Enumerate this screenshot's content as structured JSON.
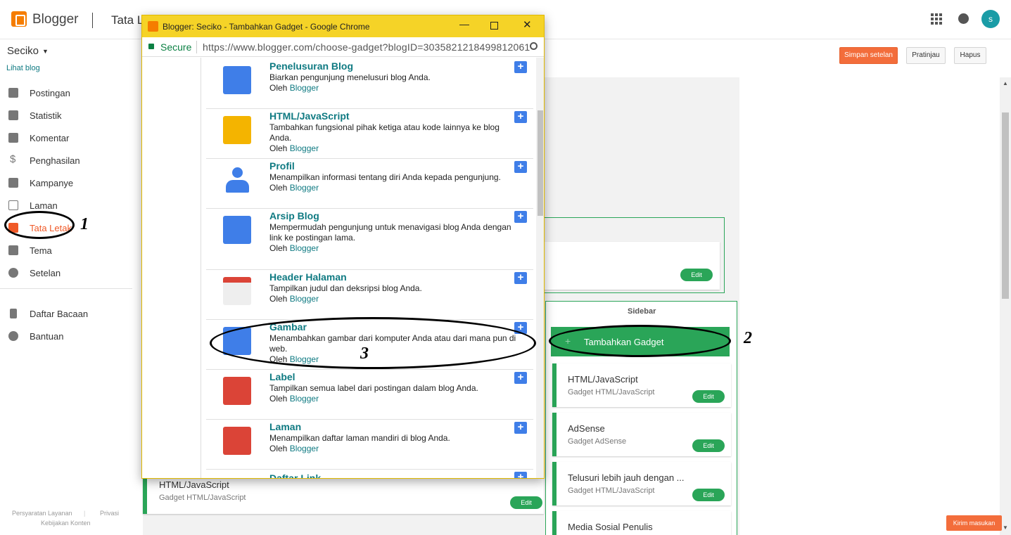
{
  "app": {
    "brand": "Blogger",
    "page_title": "Tata Letak",
    "avatar_letter": "s"
  },
  "blog": {
    "name": "Seciko",
    "view_link": "Lihat blog"
  },
  "toolbar": {
    "save_label": "Simpan setelan",
    "preview_label": "Pratinjau",
    "delete_label": "Hapus"
  },
  "nav": {
    "items": [
      {
        "label": "Postingan",
        "icon": "posts-icon"
      },
      {
        "label": "Statistik",
        "icon": "stats-icon"
      },
      {
        "label": "Komentar",
        "icon": "comments-icon"
      },
      {
        "label": "Penghasilan",
        "icon": "dollar-icon"
      },
      {
        "label": "Kampanye",
        "icon": "campaign-icon"
      },
      {
        "label": "Laman",
        "icon": "pages-icon"
      },
      {
        "label": "Tata Letak",
        "icon": "layout-icon",
        "active": true
      },
      {
        "label": "Tema",
        "icon": "theme-icon"
      },
      {
        "label": "Setelan",
        "icon": "settings-icon"
      },
      {
        "label": "Daftar Bacaan",
        "icon": "bookmark-icon"
      },
      {
        "label": "Bantuan",
        "icon": "help-icon"
      }
    ],
    "footer": {
      "terms": "Persyaratan Layanan",
      "privacy": "Privasi",
      "content_policy": "Kebijakan Konten"
    }
  },
  "layout": {
    "sidebar_title": "Sidebar",
    "add_gadget_label": "Tambahkan Gadget",
    "section_edit_label": "Edit",
    "sidebar_gadgets": [
      {
        "title": "HTML/JavaScript",
        "subtitle": "Gadget HTML/JavaScript",
        "edit": "Edit"
      },
      {
        "title": "AdSense",
        "subtitle": "Gadget AdSense",
        "edit": "Edit"
      },
      {
        "title": "Telusuri lebih jauh dengan ...",
        "subtitle": "Gadget HTML/JavaScript",
        "edit": "Edit"
      },
      {
        "title": "Media Sosial Penulis",
        "subtitle": "",
        "edit": ""
      }
    ],
    "main_gadget": {
      "title": "HTML/JavaScript",
      "subtitle": "Gadget HTML/JavaScript",
      "edit": "Edit"
    },
    "feedback_label": "Kirim masukan"
  },
  "annotations": {
    "one": "1",
    "two": "2",
    "three": "3"
  },
  "popup": {
    "title": "Blogger: Seciko - Tambahkan Gadget - Google Chrome",
    "secure": "Secure",
    "url": "https://www.blogger.com/choose-gadget?blogID=3035821218499812061",
    "author_prefix": "Oleh",
    "author_name": "Blogger",
    "gadgets": [
      {
        "name": "Penelusuran Blog",
        "desc": "Biarkan pengunjung menelusuri blog Anda.",
        "icon": "search-gadget-icon",
        "color": "#3f7ee8"
      },
      {
        "name": "HTML/JavaScript",
        "desc": "Tambahkan fungsional pihak ketiga atau kode lainnya ke blog Anda.",
        "icon": "code-gadget-icon",
        "color": "#f4b400"
      },
      {
        "name": "Profil",
        "desc": "Menampilkan informasi tentang diri Anda kepada pengunjung.",
        "icon": "profile-gadget-icon",
        "color": "#3f7ee8"
      },
      {
        "name": "Arsip Blog",
        "desc": "Mempermudah pengunjung untuk menavigasi blog Anda dengan link ke postingan lama.",
        "icon": "archive-gadget-icon",
        "color": "#3f7ee8"
      },
      {
        "name": "Header Halaman",
        "desc": "Tampilkan judul dan deksripsi blog Anda.",
        "icon": "header-gadget-icon",
        "color": "#db4437"
      },
      {
        "name": "Gambar",
        "desc": "Menambahkan gambar dari komputer Anda atau dari mana pun di web.",
        "icon": "image-gadget-icon",
        "color": "#3f7ee8"
      },
      {
        "name": "Label",
        "desc": "Tampilkan semua label dari postingan dalam blog Anda.",
        "icon": "label-gadget-icon",
        "color": "#db4437"
      },
      {
        "name": "Laman",
        "desc": "Menampilkan daftar laman mandiri di blog Anda.",
        "icon": "pages-gadget-icon",
        "color": "#db4437"
      },
      {
        "name": "Daftar Link",
        "desc": "",
        "icon": "links-gadget-icon",
        "color": "#3f7ee8"
      }
    ]
  }
}
